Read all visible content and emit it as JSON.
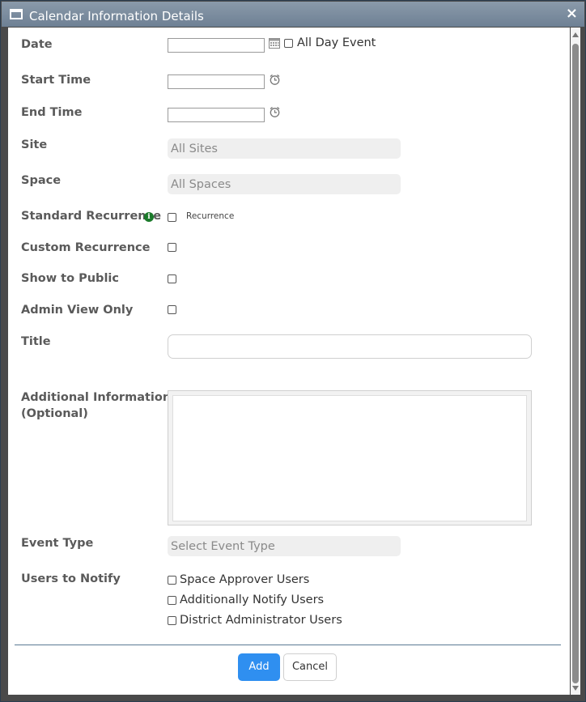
{
  "window": {
    "title": "Calendar Information Details",
    "close_glyph": "×"
  },
  "form": {
    "date_label": "Date",
    "all_day_label": "All Day Event",
    "start_time_label": "Start Time",
    "end_time_label": "End Time",
    "site_label": "Site",
    "site_value": "All Sites",
    "space_label": "Space",
    "space_value": "All Spaces",
    "standard_recurrence_label": "Standard Recurrence",
    "recurrence_label": "Recurrence",
    "custom_recurrence_label": "Custom Recurrence",
    "show_public_label": "Show to Public",
    "admin_view_label": "Admin View Only",
    "title_label": "Title",
    "additional_info_label_line1": "Additional Information",
    "additional_info_label_line2": "(Optional)",
    "event_type_label": "Event Type",
    "event_type_value": "Select Event Type",
    "users_notify_label": "Users to Notify",
    "notify_options": [
      "Space Approver Users",
      "Additionally Notify Users",
      "District Administrator Users"
    ]
  },
  "buttons": {
    "add": "Add",
    "cancel": "Cancel"
  },
  "colors": {
    "accent": "#2f8ff0",
    "titlebar": "#7a8ca0",
    "info_icon": "#1a7a2a"
  }
}
